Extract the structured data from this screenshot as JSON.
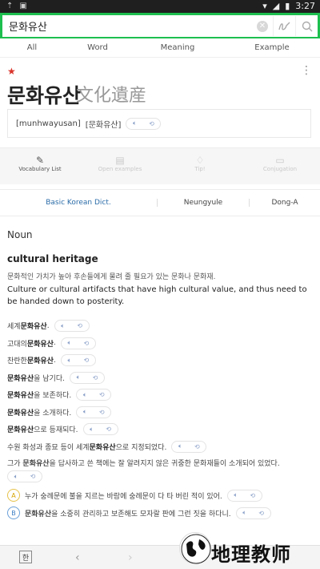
{
  "status": {
    "time": "3:27"
  },
  "search": {
    "query": "문화유산"
  },
  "tabs": [
    "All",
    "Word",
    "Meaning",
    "Example"
  ],
  "entry": {
    "headword": "문화유산",
    "hanja": "文化遺産",
    "romanization": "[munhwayusan]",
    "pronunciation": "[문화유산]"
  },
  "tools": [
    "Vocabulary List",
    "Open examples",
    "Tip!",
    "Conjugation"
  ],
  "sources": [
    "Basic Korean Dict.",
    "Neungyule",
    "Dong-A"
  ],
  "definition": {
    "pos": "Noun",
    "english": "cultural heritage",
    "korean": "문화적인 가치가 높아 후손들에게 물려 줄 필요가 있는 문화나 문화재.",
    "description": "Culture or cultural artifacts that have high cultural value, and thus need to be handed down to posterity."
  },
  "examples": {
    "e1_pre": "세계 ",
    "e1_bold": "문화유산",
    "e1_post": ".",
    "e2_pre": "고대의 ",
    "e2_bold": "문화유산",
    "e2_post": ".",
    "e3_pre": "찬란한 ",
    "e3_bold": "문화유산",
    "e3_post": ".",
    "e4_bold": "문화유산",
    "e4_post": "을 남기다.",
    "e5_bold": "문화유산",
    "e5_post": "을 보존하다.",
    "e6_bold": "문화유산",
    "e6_post": "을 소개하다.",
    "e7_bold": "문화유산",
    "e7_post": "으로 등재되다.",
    "e8_pre": "수원 화성과 종묘 등이 세계 ",
    "e8_bold": "문화유산",
    "e8_post": "으로 지정되었다.",
    "e9_pre": "그가 ",
    "e9_bold": "문화유산",
    "e9_post": "을 답사하고 쓴 책에는 잘 알려지지 않은 귀중한 문화재들이 소개되어 있었다.",
    "a_label": "A",
    "a_text": "누가 숭례문에 불을 지르는 바람에 숭례문이 다 타 버린 적이 있어.",
    "b_label": "B",
    "b_bold": "문화유산",
    "b_post": "을 소중히 관리하고 보존해도 모자랄 판에 그런 짓을 하다니."
  },
  "bottom": {
    "han_label": "한"
  },
  "watermark": {
    "text": "地理教师"
  }
}
